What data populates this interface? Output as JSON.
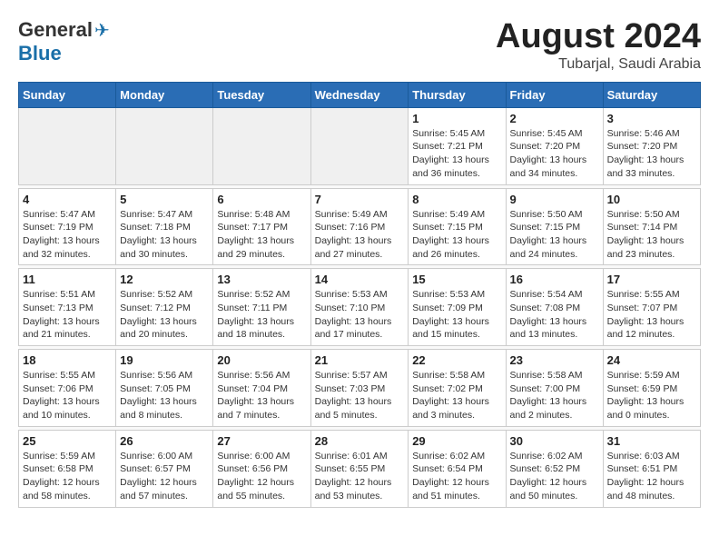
{
  "logo": {
    "general": "General",
    "blue": "Blue"
  },
  "title": {
    "month_year": "August 2024",
    "location": "Tubarjal, Saudi Arabia"
  },
  "weekdays": [
    "Sunday",
    "Monday",
    "Tuesday",
    "Wednesday",
    "Thursday",
    "Friday",
    "Saturday"
  ],
  "weeks": [
    [
      {
        "day": "",
        "empty": true
      },
      {
        "day": "",
        "empty": true
      },
      {
        "day": "",
        "empty": true
      },
      {
        "day": "",
        "empty": true
      },
      {
        "day": "1",
        "sunrise": "5:45 AM",
        "sunset": "7:21 PM",
        "daylight": "13 hours and 36 minutes."
      },
      {
        "day": "2",
        "sunrise": "5:45 AM",
        "sunset": "7:20 PM",
        "daylight": "13 hours and 34 minutes."
      },
      {
        "day": "3",
        "sunrise": "5:46 AM",
        "sunset": "7:20 PM",
        "daylight": "13 hours and 33 minutes."
      }
    ],
    [
      {
        "day": "4",
        "sunrise": "5:47 AM",
        "sunset": "7:19 PM",
        "daylight": "13 hours and 32 minutes."
      },
      {
        "day": "5",
        "sunrise": "5:47 AM",
        "sunset": "7:18 PM",
        "daylight": "13 hours and 30 minutes."
      },
      {
        "day": "6",
        "sunrise": "5:48 AM",
        "sunset": "7:17 PM",
        "daylight": "13 hours and 29 minutes."
      },
      {
        "day": "7",
        "sunrise": "5:49 AM",
        "sunset": "7:16 PM",
        "daylight": "13 hours and 27 minutes."
      },
      {
        "day": "8",
        "sunrise": "5:49 AM",
        "sunset": "7:15 PM",
        "daylight": "13 hours and 26 minutes."
      },
      {
        "day": "9",
        "sunrise": "5:50 AM",
        "sunset": "7:15 PM",
        "daylight": "13 hours and 24 minutes."
      },
      {
        "day": "10",
        "sunrise": "5:50 AM",
        "sunset": "7:14 PM",
        "daylight": "13 hours and 23 minutes."
      }
    ],
    [
      {
        "day": "11",
        "sunrise": "5:51 AM",
        "sunset": "7:13 PM",
        "daylight": "13 hours and 21 minutes."
      },
      {
        "day": "12",
        "sunrise": "5:52 AM",
        "sunset": "7:12 PM",
        "daylight": "13 hours and 20 minutes."
      },
      {
        "day": "13",
        "sunrise": "5:52 AM",
        "sunset": "7:11 PM",
        "daylight": "13 hours and 18 minutes."
      },
      {
        "day": "14",
        "sunrise": "5:53 AM",
        "sunset": "7:10 PM",
        "daylight": "13 hours and 17 minutes."
      },
      {
        "day": "15",
        "sunrise": "5:53 AM",
        "sunset": "7:09 PM",
        "daylight": "13 hours and 15 minutes."
      },
      {
        "day": "16",
        "sunrise": "5:54 AM",
        "sunset": "7:08 PM",
        "daylight": "13 hours and 13 minutes."
      },
      {
        "day": "17",
        "sunrise": "5:55 AM",
        "sunset": "7:07 PM",
        "daylight": "13 hours and 12 minutes."
      }
    ],
    [
      {
        "day": "18",
        "sunrise": "5:55 AM",
        "sunset": "7:06 PM",
        "daylight": "13 hours and 10 minutes."
      },
      {
        "day": "19",
        "sunrise": "5:56 AM",
        "sunset": "7:05 PM",
        "daylight": "13 hours and 8 minutes."
      },
      {
        "day": "20",
        "sunrise": "5:56 AM",
        "sunset": "7:04 PM",
        "daylight": "13 hours and 7 minutes."
      },
      {
        "day": "21",
        "sunrise": "5:57 AM",
        "sunset": "7:03 PM",
        "daylight": "13 hours and 5 minutes."
      },
      {
        "day": "22",
        "sunrise": "5:58 AM",
        "sunset": "7:02 PM",
        "daylight": "13 hours and 3 minutes."
      },
      {
        "day": "23",
        "sunrise": "5:58 AM",
        "sunset": "7:00 PM",
        "daylight": "13 hours and 2 minutes."
      },
      {
        "day": "24",
        "sunrise": "5:59 AM",
        "sunset": "6:59 PM",
        "daylight": "13 hours and 0 minutes."
      }
    ],
    [
      {
        "day": "25",
        "sunrise": "5:59 AM",
        "sunset": "6:58 PM",
        "daylight": "12 hours and 58 minutes."
      },
      {
        "day": "26",
        "sunrise": "6:00 AM",
        "sunset": "6:57 PM",
        "daylight": "12 hours and 57 minutes."
      },
      {
        "day": "27",
        "sunrise": "6:00 AM",
        "sunset": "6:56 PM",
        "daylight": "12 hours and 55 minutes."
      },
      {
        "day": "28",
        "sunrise": "6:01 AM",
        "sunset": "6:55 PM",
        "daylight": "12 hours and 53 minutes."
      },
      {
        "day": "29",
        "sunrise": "6:02 AM",
        "sunset": "6:54 PM",
        "daylight": "12 hours and 51 minutes."
      },
      {
        "day": "30",
        "sunrise": "6:02 AM",
        "sunset": "6:52 PM",
        "daylight": "12 hours and 50 minutes."
      },
      {
        "day": "31",
        "sunrise": "6:03 AM",
        "sunset": "6:51 PM",
        "daylight": "12 hours and 48 minutes."
      }
    ]
  ],
  "labels": {
    "sunrise": "Sunrise:",
    "sunset": "Sunset:",
    "daylight": "Daylight:"
  }
}
